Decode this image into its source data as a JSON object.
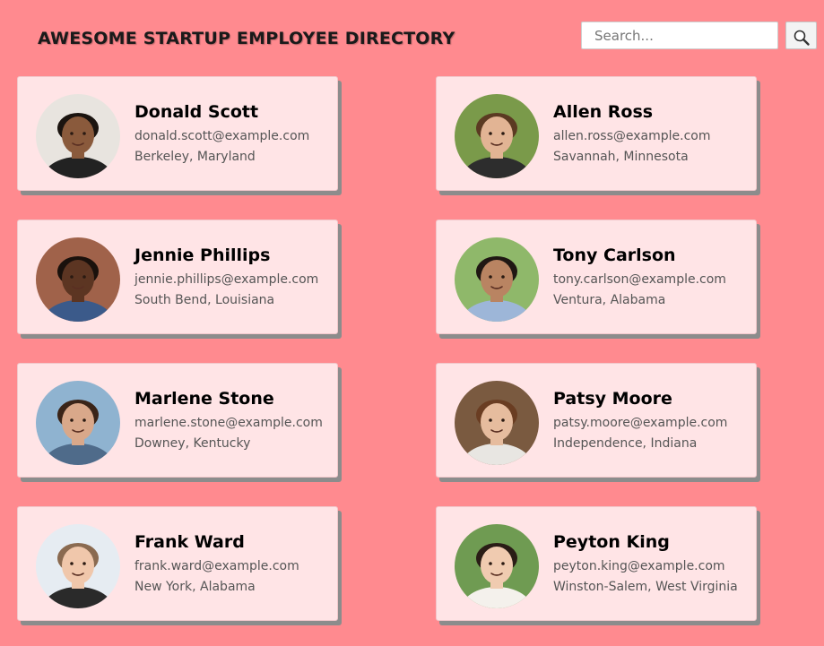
{
  "header": {
    "title": "AWESOME STARTUP EMPLOYEE DIRECTORY"
  },
  "search": {
    "placeholder": "Search...",
    "value": "",
    "button_icon": "magnifier-icon"
  },
  "employees": [
    {
      "name": "Donald Scott",
      "email": "donald.scott@example.com",
      "location": "Berkeley, Maryland",
      "skin": "#8a5a3c",
      "hair": "#1b1410",
      "bg": "#e8e4df",
      "shirt": "#222222"
    },
    {
      "name": "Allen Ross",
      "email": "allen.ross@example.com",
      "location": "Savannah, Minnesota",
      "skin": "#e2b494",
      "hair": "#5b3a22",
      "bg": "#7a9a4a",
      "shirt": "#2d2d2d"
    },
    {
      "name": "Jennie Phillips",
      "email": "jennie.phillips@example.com",
      "location": "South Bend, Louisiana",
      "skin": "#5c3522",
      "hair": "#1a110c",
      "bg": "#a0624a",
      "shirt": "#3b5a8a"
    },
    {
      "name": "Tony Carlson",
      "email": "tony.carlson@example.com",
      "location": "Ventura, Alabama",
      "skin": "#b98462",
      "hair": "#1f1713",
      "bg": "#8fb86a",
      "shirt": "#9db6d8"
    },
    {
      "name": "Marlene Stone",
      "email": "marlene.stone@example.com",
      "location": "Downey, Kentucky",
      "skin": "#d9a88a",
      "hair": "#3a2418",
      "bg": "#8fb3d0",
      "shirt": "#4f6b8a"
    },
    {
      "name": "Patsy Moore",
      "email": "patsy.moore@example.com",
      "location": "Independence, Indiana",
      "skin": "#e6bc9e",
      "hair": "#6a3d22",
      "bg": "#7a5a40",
      "shirt": "#e8e6e2"
    },
    {
      "name": "Frank Ward",
      "email": "frank.ward@example.com",
      "location": "New York, Alabama",
      "skin": "#f0c7ab",
      "hair": "#8a6a50",
      "bg": "#e6ecf2",
      "shirt": "#2a2a2a"
    },
    {
      "name": "Peyton King",
      "email": "peyton.king@example.com",
      "location": "Winston-Salem, West Virginia",
      "skin": "#f0cbb0",
      "hair": "#2a1d16",
      "bg": "#6f9b52",
      "shirt": "#f4f1ec"
    }
  ]
}
